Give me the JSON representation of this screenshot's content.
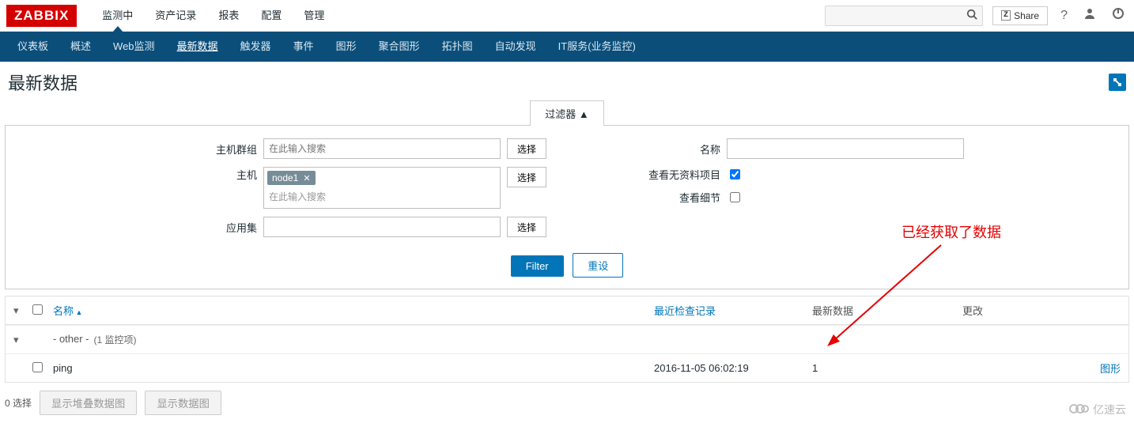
{
  "brand": "ZABBIX",
  "top_nav": {
    "items": [
      {
        "label": "监测中",
        "active": true
      },
      {
        "label": "资产记录",
        "active": false
      },
      {
        "label": "报表",
        "active": false
      },
      {
        "label": "配置",
        "active": false
      },
      {
        "label": "管理",
        "active": false
      }
    ],
    "share": "Share"
  },
  "sub_nav": {
    "items": [
      {
        "label": "仪表板"
      },
      {
        "label": "概述"
      },
      {
        "label": "Web监测"
      },
      {
        "label": "最新数据",
        "active": true
      },
      {
        "label": "触发器"
      },
      {
        "label": "事件"
      },
      {
        "label": "图形"
      },
      {
        "label": "聚合图形"
      },
      {
        "label": "拓扑图"
      },
      {
        "label": "自动发现"
      },
      {
        "label": "IT服务(业务监控)"
      }
    ]
  },
  "page_title": "最新数据",
  "filter": {
    "tab_label": "过滤器 ▲",
    "labels": {
      "host_group": "主机群组",
      "host": "主机",
      "application": "应用集",
      "name": "名称",
      "show_no_data": "查看无资料项目",
      "show_details": "查看细节"
    },
    "placeholders": {
      "search_here": "在此输入搜索"
    },
    "select_btn": "选择",
    "host_tags": [
      "node1"
    ],
    "show_no_data_checked": true,
    "show_details_checked": false,
    "buttons": {
      "filter": "Filter",
      "reset": "重设"
    }
  },
  "table": {
    "headers": {
      "name": "名称",
      "last_check": "最近检查记录",
      "last_data": "最新数据",
      "change": "更改"
    },
    "group_label_prefix": "- other -",
    "group_count_text": "(1 监控项)",
    "rows": [
      {
        "name": "ping",
        "last_check": "2016-11-05 06:02:19",
        "last_data": "1",
        "change": "",
        "action": "图形"
      }
    ]
  },
  "footer": {
    "selected_text": "0 选择",
    "stacked_btn": "显示堆叠数据图",
    "graph_btn": "显示数据图"
  },
  "annotation": "已经获取了数据",
  "watermark": "亿速云"
}
